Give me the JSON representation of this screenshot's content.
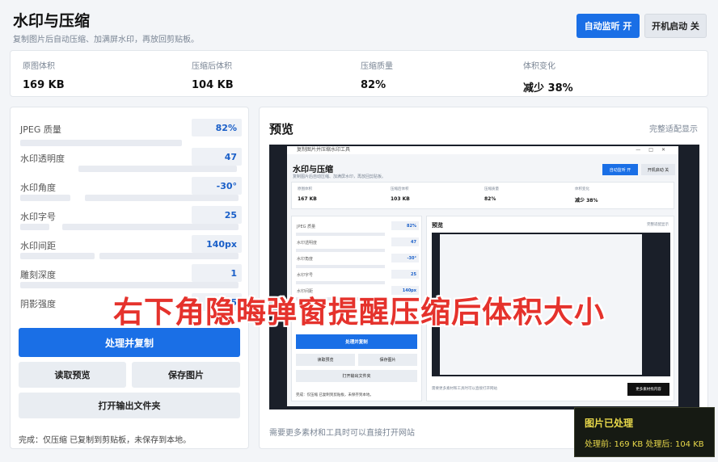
{
  "header": {
    "title": "水印与压缩",
    "subtitle": "复制图片后自动压缩、加满屏水印，再放回剪贴板。",
    "auto_monitor_button": "自动监听  开",
    "boot_start_button": "开机启动  关"
  },
  "stats": [
    {
      "label": "原图体积",
      "value": "169 KB"
    },
    {
      "label": "压缩后体积",
      "value": "104 KB"
    },
    {
      "label": "压缩质量",
      "value": "82%"
    },
    {
      "label": "体积变化",
      "value": "减少 38%"
    }
  ],
  "settings": [
    {
      "label": "JPEG 质量",
      "value": "82%"
    },
    {
      "label": "水印透明度",
      "value": "47"
    },
    {
      "label": "水印角度",
      "value": "-30°"
    },
    {
      "label": "水印字号",
      "value": "25"
    },
    {
      "label": "水印间距",
      "value": "140px"
    },
    {
      "label": "雕刻深度",
      "value": "1"
    },
    {
      "label": "阴影强度",
      "value": "35"
    }
  ],
  "actions": {
    "process_copy": "处理并复制",
    "read_preview": "读取预览",
    "save_image": "保存图片",
    "open_output": "打开输出文件夹"
  },
  "status": "完成：仅压缩 已复制到剪贴板，未保存到本地。",
  "preview": {
    "title": "预览",
    "fit_label": "完整适配显示",
    "footer": "需要更多素材和工具时可以直接打开网站"
  },
  "mini": {
    "window_title": "复制图片并压缩水印工具",
    "title": "水印与压缩",
    "subtitle": "复制图片后自动压缩、加满屏水印，再放回剪贴板。",
    "auto_btn": "自动监听  开",
    "boot_btn": "开机启动  关",
    "stats": [
      {
        "label": "原图体积",
        "value": "167 KB"
      },
      {
        "label": "压缩后体积",
        "value": "103 KB"
      },
      {
        "label": "压缩质量",
        "value": "82%"
      },
      {
        "label": "体积变化",
        "value": "减少 38%"
      }
    ],
    "settings": [
      {
        "label": "JPEG 质量",
        "value": "82%"
      },
      {
        "label": "水印透明度",
        "value": "47"
      },
      {
        "label": "水印角度",
        "value": "-30°"
      },
      {
        "label": "水印字号",
        "value": "25"
      },
      {
        "label": "水印间距",
        "value": "140px"
      }
    ],
    "process_copy": "处理并复制",
    "read_preview": "读取预览",
    "save_image": "保存图片",
    "open_output": "打开输出文件夹",
    "status": "完成：仅压缩 已复制到剪贴板，未保存到本地。",
    "preview_title": "预览",
    "fit_label": "完整适配显示",
    "footer": "需要更多素材和工具时可以直接打开网站",
    "more_button": "更多素材找内容"
  },
  "caption": "右下角隐晦弹窗提醒压缩后体积大小",
  "toast": {
    "title": "图片已处理",
    "body": "处理前: 169 KB  处理后: 104 KB"
  }
}
